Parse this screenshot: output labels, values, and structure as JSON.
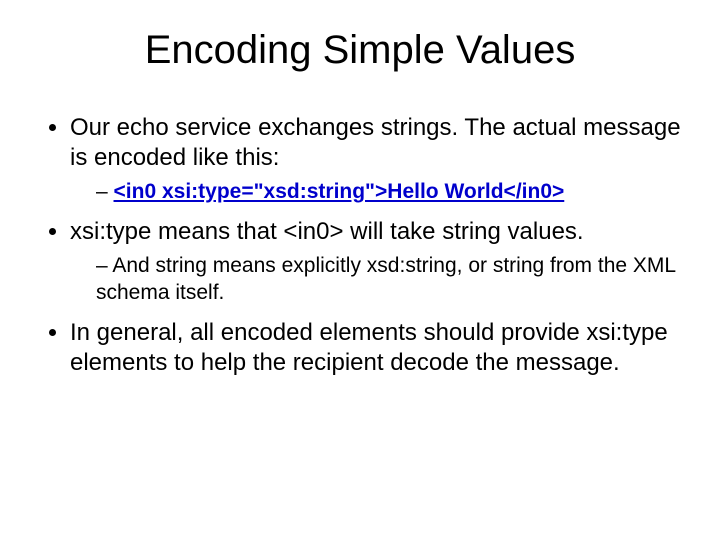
{
  "title": "Encoding Simple Values",
  "bullets": {
    "b1": "Our echo service exchanges strings.  The actual message is encoded like this:",
    "b1_sub": "<in0 xsi:type=\"xsd:string\">Hello World</in0>",
    "b2": "xsi:type means that <in0> will take string values.",
    "b2_sub": "And string means explicitly xsd:string, or string from the XML schema itself.",
    "b3": "In general, all encoded elements should provide xsi:type elements to help the recipient decode the message."
  }
}
